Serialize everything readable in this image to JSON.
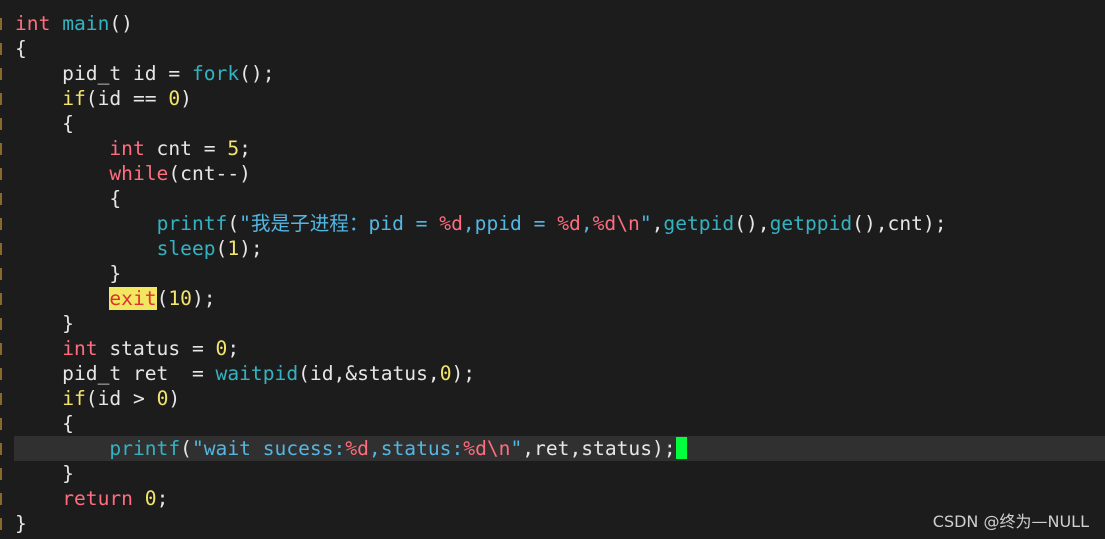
{
  "editor": {
    "lines": [
      {
        "parts": [
          {
            "t": "int",
            "c": "kw"
          },
          {
            "t": " "
          },
          {
            "t": "main",
            "c": "fn"
          },
          {
            "t": "()"
          }
        ]
      },
      {
        "parts": [
          {
            "t": "{"
          }
        ]
      },
      {
        "parts": [
          {
            "t": "    pid_t id = "
          },
          {
            "t": "fork",
            "c": "fn"
          },
          {
            "t": "();"
          }
        ]
      },
      {
        "parts": [
          {
            "t": "    "
          },
          {
            "t": "if",
            "c": "ctl"
          },
          {
            "t": "(id == "
          },
          {
            "t": "0",
            "c": "num"
          },
          {
            "t": ")"
          }
        ]
      },
      {
        "parts": [
          {
            "t": "    {"
          }
        ]
      },
      {
        "parts": [
          {
            "t": "        "
          },
          {
            "t": "int",
            "c": "kw"
          },
          {
            "t": " cnt = "
          },
          {
            "t": "5",
            "c": "num"
          },
          {
            "t": ";"
          }
        ]
      },
      {
        "parts": [
          {
            "t": "        "
          },
          {
            "t": "while",
            "c": "kw"
          },
          {
            "t": "(cnt--)"
          }
        ]
      },
      {
        "parts": [
          {
            "t": "        {"
          }
        ]
      },
      {
        "parts": [
          {
            "t": "            "
          },
          {
            "t": "printf",
            "c": "fn"
          },
          {
            "t": "("
          },
          {
            "t": "\"我是子进程：pid = ",
            "c": "str"
          },
          {
            "t": "%d",
            "c": "fmt"
          },
          {
            "t": ",ppid = ",
            "c": "str"
          },
          {
            "t": "%d",
            "c": "fmt"
          },
          {
            "t": ",",
            "c": "str"
          },
          {
            "t": "%d\\n",
            "c": "fmt"
          },
          {
            "t": "\"",
            "c": "str"
          },
          {
            "t": ","
          },
          {
            "t": "getpid",
            "c": "fn"
          },
          {
            "t": "(),"
          },
          {
            "t": "getppid",
            "c": "fn"
          },
          {
            "t": "(),cnt);"
          }
        ]
      },
      {
        "parts": [
          {
            "t": "            "
          },
          {
            "t": "sleep",
            "c": "fn"
          },
          {
            "t": "("
          },
          {
            "t": "1",
            "c": "num"
          },
          {
            "t": ");"
          }
        ]
      },
      {
        "parts": [
          {
            "t": "        }"
          }
        ]
      },
      {
        "parts": [
          {
            "t": "        "
          },
          {
            "t": "exit",
            "c": "hl"
          },
          {
            "t": "("
          },
          {
            "t": "10",
            "c": "num"
          },
          {
            "t": ");"
          }
        ]
      },
      {
        "parts": [
          {
            "t": "    }"
          }
        ]
      },
      {
        "parts": [
          {
            "t": "    "
          },
          {
            "t": "int",
            "c": "kw"
          },
          {
            "t": " status = "
          },
          {
            "t": "0",
            "c": "num"
          },
          {
            "t": ";"
          }
        ]
      },
      {
        "parts": [
          {
            "t": "    pid_t ret  = "
          },
          {
            "t": "waitpid",
            "c": "fn"
          },
          {
            "t": "(id,&status,"
          },
          {
            "t": "0",
            "c": "num"
          },
          {
            "t": ");"
          }
        ]
      },
      {
        "parts": [
          {
            "t": "    "
          },
          {
            "t": "if",
            "c": "ctl"
          },
          {
            "t": "(id > "
          },
          {
            "t": "0",
            "c": "num"
          },
          {
            "t": ")"
          }
        ]
      },
      {
        "parts": [
          {
            "t": "    {"
          }
        ]
      },
      {
        "parts": [
          {
            "t": "        "
          },
          {
            "t": "printf",
            "c": "fn"
          },
          {
            "t": "("
          },
          {
            "t": "\"wait sucess:",
            "c": "str"
          },
          {
            "t": "%d",
            "c": "fmt"
          },
          {
            "t": ",status:",
            "c": "str"
          },
          {
            "t": "%d\\n",
            "c": "fmt"
          },
          {
            "t": "\"",
            "c": "str"
          },
          {
            "t": ",ret,status);"
          }
        ],
        "cursor": true
      },
      {
        "parts": [
          {
            "t": "    }"
          }
        ]
      },
      {
        "parts": [
          {
            "t": "    "
          },
          {
            "t": "return",
            "c": "kw"
          },
          {
            "t": " "
          },
          {
            "t": "0",
            "c": "num"
          },
          {
            "t": ";"
          }
        ]
      },
      {
        "parts": [
          {
            "t": "}"
          }
        ]
      }
    ]
  },
  "watermark": "CSDN @终为—NULL",
  "colors": {
    "background": "#1c1c1c",
    "keyword": "#ff6d7e",
    "function": "#33b3c2",
    "number": "#f3e46c",
    "string": "#53b6e3",
    "cursor": "#00ff3c",
    "search_highlight": "#f1e760"
  }
}
